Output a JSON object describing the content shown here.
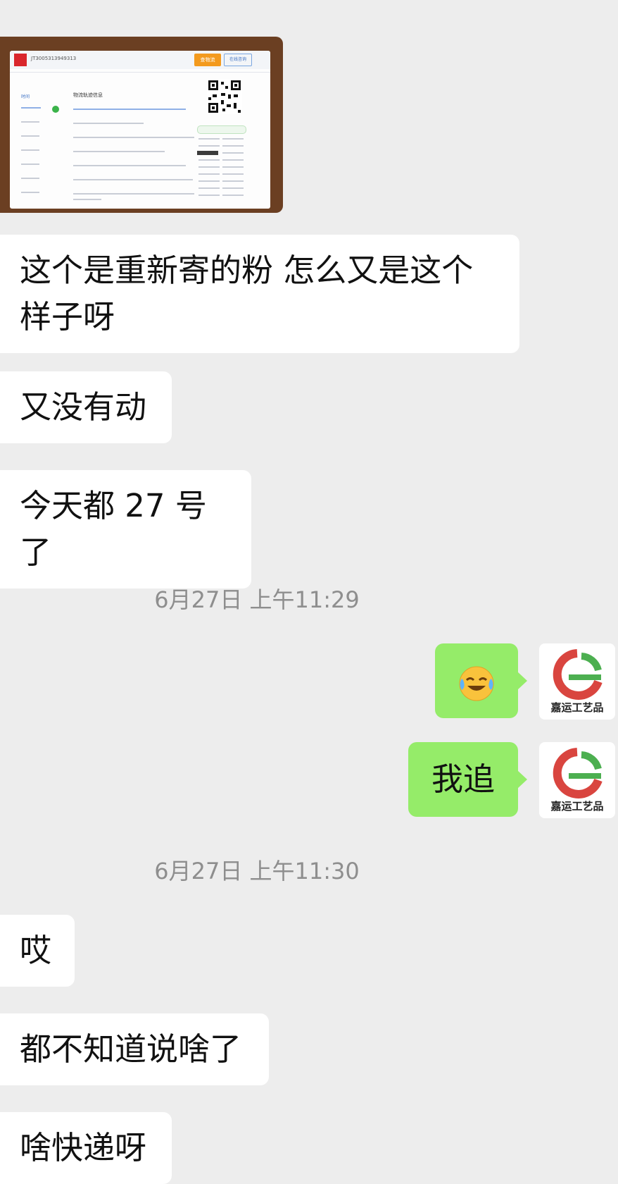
{
  "thumbnail": {
    "order_no": "JT3005313949313",
    "search_button": "查物流",
    "right_button": "在线咨询",
    "section_title": "物流轨迹信息",
    "tab": "时间"
  },
  "messages_in": [
    {
      "text": "这个是重新寄的粉  怎么又是这个样子呀"
    },
    {
      "text": "又没有动"
    },
    {
      "text": "今天都 27 号了"
    }
  ],
  "time_1": "6月27日 上午11:29",
  "messages_out": [
    {
      "text": "😂"
    },
    {
      "text": "我追"
    }
  ],
  "avatar_label": "嘉运工艺品",
  "time_2": "6月27日 上午11:30",
  "messages_in_2": [
    {
      "text": "哎"
    },
    {
      "text": "都不知道说啥了"
    },
    {
      "text": "啥快递呀"
    }
  ]
}
